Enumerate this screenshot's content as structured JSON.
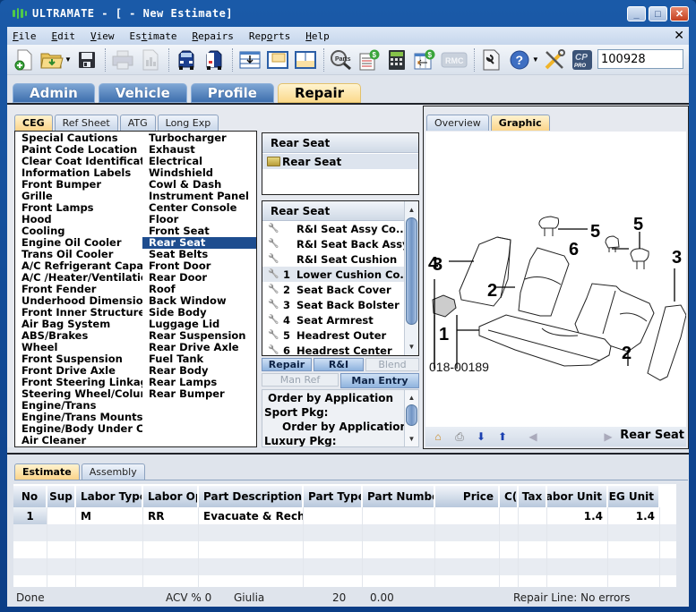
{
  "window": {
    "title": "ULTRAMATE - [ - New Estimate]",
    "minimize": "_",
    "maximize": "□",
    "close": "✕"
  },
  "menu": {
    "items": [
      {
        "label": "File",
        "mnemonic": "F"
      },
      {
        "label": "Edit",
        "mnemonic": "E"
      },
      {
        "label": "View",
        "mnemonic": "V"
      },
      {
        "label": "Estimate",
        "mnemonic": "t"
      },
      {
        "label": "Repairs",
        "mnemonic": "R"
      },
      {
        "label": "Reports",
        "mnemonic": "o"
      },
      {
        "label": "Help",
        "mnemonic": "H"
      }
    ],
    "close": "✕"
  },
  "toolbar": {
    "icons": [
      "new-document-icon",
      "open-folder-icon",
      "save-icon",
      "print-icon",
      "print-preview-icon",
      "vehicle-front-icon",
      "vehicle-rear-icon",
      "insert-line-icon",
      "window-layout-top-icon",
      "window-layout-bottom-icon",
      "parts-search-icon",
      "price-report-icon",
      "calculator-icon",
      "price-grid-icon",
      "rmc-icon",
      "document-tools-icon",
      "help-icon",
      "tools-icon",
      "cp-pro-icon"
    ],
    "rmc_label": "RMC",
    "parts_label": "Parts",
    "cp_label": "CP",
    "pro_label": "PRO",
    "search_value": "100928"
  },
  "main_tabs": [
    {
      "label": "Admin",
      "active": false
    },
    {
      "label": "Vehicle",
      "active": false
    },
    {
      "label": "Profile",
      "active": false
    },
    {
      "label": "Repair",
      "active": true
    }
  ],
  "ceg_tabs": [
    {
      "label": "CEG",
      "active": true
    },
    {
      "label": "Ref Sheet",
      "active": false
    },
    {
      "label": "ATG",
      "active": false
    },
    {
      "label": "Long Exp",
      "active": false
    }
  ],
  "ceg_list": {
    "col1": [
      "Special Cautions",
      "Paint Code Location",
      "Clear Coat Identificatio",
      "Information Labels",
      "Front Bumper",
      "Grille",
      "Front Lamps",
      "Hood",
      "Cooling",
      "Engine Oil Cooler",
      "Trans Oil Cooler",
      "A/C Refrigerant Capac",
      "A/C /Heater/Ventilatic",
      "Front Fender",
      "Underhood Dimension:",
      "Front Inner Structure",
      "Air Bag System",
      "ABS/Brakes",
      "Wheel",
      "Front Suspension",
      "Front Drive Axle",
      "Front Steering Linkage",
      "Steering Wheel/Colum",
      "Engine/Trans",
      "Engine/Trans Mounts",
      "Engine/Body Under Cc",
      "Air Cleaner"
    ],
    "col2": [
      "Turbocharger",
      "Exhaust",
      "Electrical",
      "Windshield",
      "Cowl & Dash",
      "Instrument Panel",
      "Center Console",
      "Floor",
      "Front Seat",
      "Rear Seat",
      "Seat Belts",
      "Front Door",
      "Rear Door",
      "Roof",
      "Back Window",
      "Side Body",
      "Luggage Lid",
      "Rear Suspension",
      "Rear Drive Axle",
      "Fuel Tank",
      "Rear Body",
      "Rear Lamps",
      "Rear Bumper"
    ],
    "selected": "Rear Seat"
  },
  "category_box": {
    "header": "Rear Seat",
    "folder": "Rear Seat"
  },
  "operations_box": {
    "header": "Rear Seat",
    "items": [
      {
        "num": "",
        "label": "R&I Seat Assy Co...",
        "selected": false
      },
      {
        "num": "",
        "label": "R&I Seat Back Assy",
        "selected": false
      },
      {
        "num": "",
        "label": "R&I Seat Cushion",
        "selected": false
      },
      {
        "num": "1",
        "label": "Lower Cushion Co...",
        "selected": true
      },
      {
        "num": "2",
        "label": "Seat Back Cover",
        "selected": false
      },
      {
        "num": "3",
        "label": "Seat Back Bolster",
        "selected": false
      },
      {
        "num": "4",
        "label": "Seat Armrest",
        "selected": false
      },
      {
        "num": "5",
        "label": "Headrest Outer",
        "selected": false
      },
      {
        "num": "6",
        "label": "Headrest Center",
        "selected": false
      }
    ]
  },
  "op_buttons": {
    "repair": "Repair",
    "ri": "R&I",
    "blend": "Blend",
    "man_ref": "Man Ref",
    "man_entry": "Man Entry"
  },
  "notes": {
    "lines": [
      "Order by Application",
      "Sport Pkg:",
      "Order by Application",
      "Luxury Pkg:"
    ]
  },
  "graphic_tabs": [
    {
      "label": "Overview",
      "active": false
    },
    {
      "label": "Graphic",
      "active": true
    }
  ],
  "graphic": {
    "callouts": [
      "1",
      "2",
      "2",
      "3",
      "3",
      "4",
      "5",
      "5",
      "6"
    ],
    "figure_id": "018-00189",
    "title": "Rear Seat"
  },
  "bottom_tabs": [
    {
      "label": "Estimate",
      "active": true
    },
    {
      "label": "Assembly",
      "active": false
    }
  ],
  "estimate_grid": {
    "columns": [
      "No",
      "Sup",
      "Labor Type",
      "Labor Op",
      "Part Description",
      "Part Type",
      "Part Number",
      "Price",
      "C(",
      "Tax",
      "Labor Unit",
      "CEG Unit"
    ],
    "rows": [
      [
        "1",
        "",
        "M",
        "RR",
        "Evacuate & Rechai",
        "",
        "",
        "",
        "",
        "",
        "1.4",
        "1.4"
      ]
    ]
  },
  "status_bar": {
    "state": "Done",
    "acv": "ACV % 0",
    "model": "Giulia",
    "count": "20",
    "amount": "0.00",
    "repair_line": "Repair Line: No errors"
  }
}
